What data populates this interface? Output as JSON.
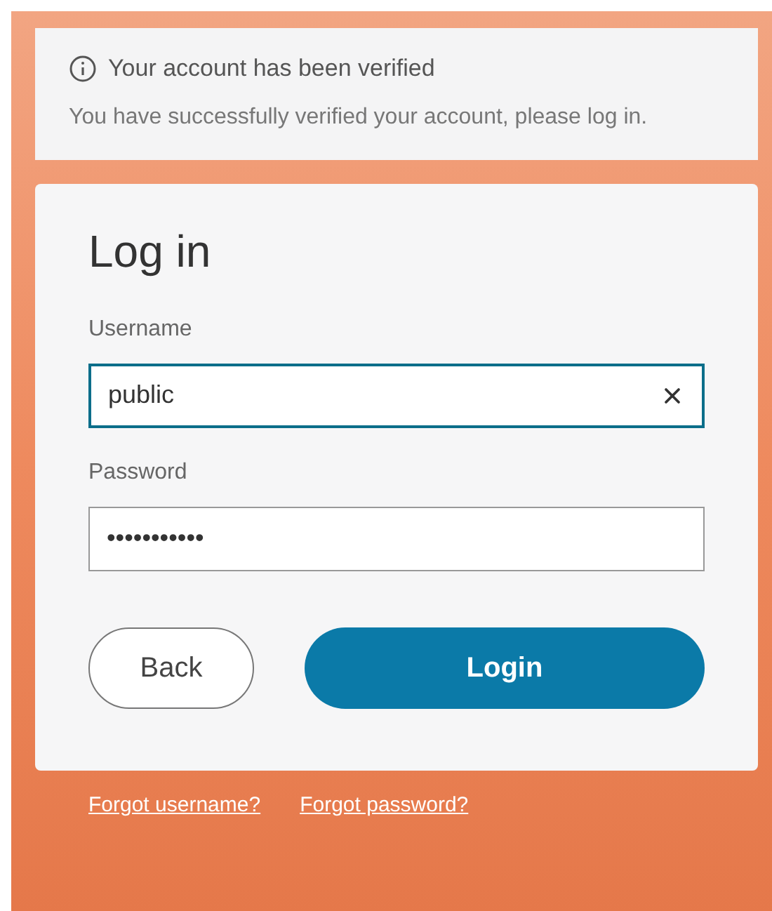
{
  "alert": {
    "title": "Your account has been verified",
    "message": "You have successfully verified your account, please log in."
  },
  "login": {
    "title": "Log in",
    "fields": [
      {
        "label": "Username",
        "value": "public",
        "focused": true,
        "clearable": true
      },
      {
        "label": "Password",
        "value": "•••••••••••",
        "focused": false,
        "clearable": false
      }
    ],
    "buttons": [
      {
        "label": "Back",
        "kind": "secondary"
      },
      {
        "label": "Login",
        "kind": "primary"
      }
    ]
  },
  "links": [
    "Forgot username?",
    "Forgot password?"
  ]
}
